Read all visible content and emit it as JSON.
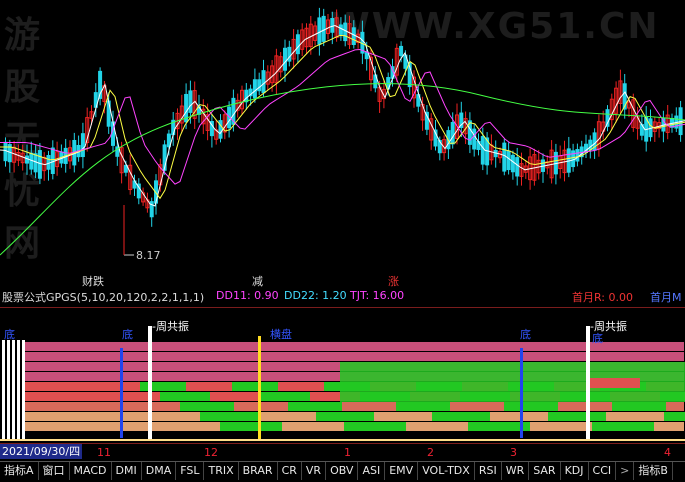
{
  "watermark": {
    "left": "游股无忧网",
    "right": "WWW.XG51.CN"
  },
  "main": {
    "low_label": "8.17"
  },
  "signals": [
    {
      "text": "财跌",
      "color": "#dddddd"
    },
    {
      "text": "减",
      "color": "#dddddd"
    },
    {
      "text": "涨",
      "color": "#ee3333"
    }
  ],
  "formula": {
    "prefix": "股票公式GPGS(5,10,20,120,2,2,1,1,1)",
    "dd11": "DD11: 0.90",
    "dd22": "DD22: 1.20",
    "tjt": "TJT: 16.00",
    "first_r": "首月R: 0.00",
    "first_m": "首月M"
  },
  "indicator": {
    "labels": [
      "周共振",
      "周共振"
    ],
    "blue_labels": [
      "底",
      "底",
      "底",
      "底"
    ],
    "yellow_label": "横盘"
  },
  "date_bar": {
    "current": "2021/09/30/四",
    "months": [
      "11",
      "12",
      "1",
      "2",
      "3",
      "4"
    ]
  },
  "tabs": [
    "指标A",
    "窗口",
    "MACD",
    "DMI",
    "DMA",
    "FSL",
    "TRIX",
    "BRAR",
    "CR",
    "VR",
    "OBV",
    "ASI",
    "EMV",
    "VOL-TDX",
    "RSI",
    "WR",
    "SAR",
    "KDJ",
    "CCI",
    "指标B"
  ],
  "colors": {
    "up": "#ee2222",
    "down": "#22d4e8",
    "ma5": "#ffffff",
    "ma10": "#ffff44",
    "ma20": "#ff44ff",
    "ma120": "#44ff44"
  }
}
